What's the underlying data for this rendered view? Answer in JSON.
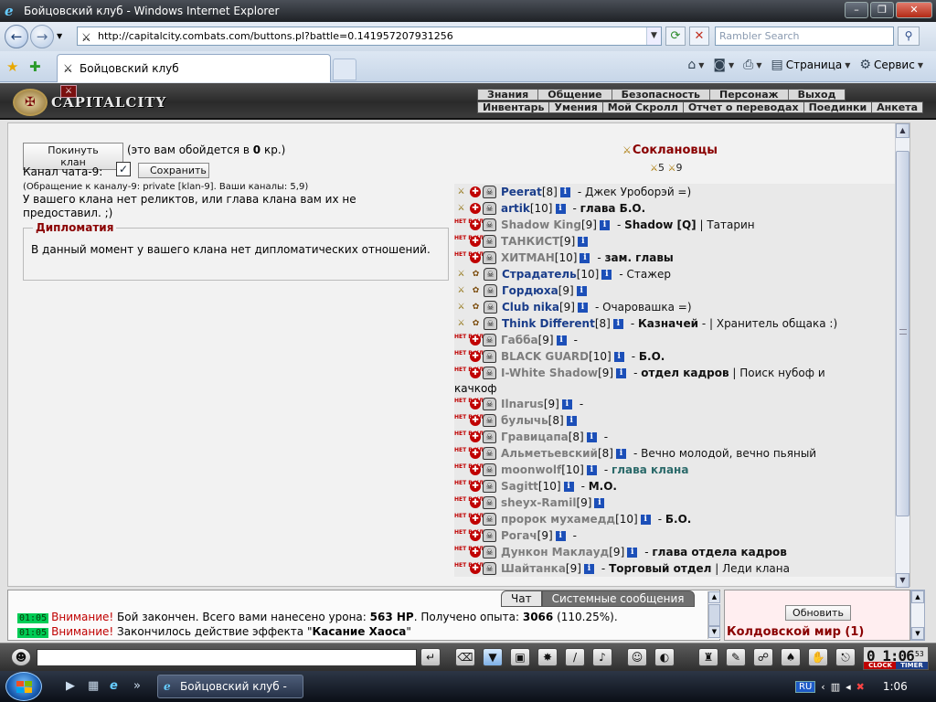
{
  "browser": {
    "window_title": "Бойцовский клуб - Windows Internet Explorer",
    "url": "http://capitalcity.combats.com/buttons.pl?battle=0.141957207931256",
    "search_placeholder": "Rambler Search",
    "tab_title": "Бойцовский клуб",
    "cmd_page": "Страница",
    "cmd_service": "Сервис"
  },
  "game": {
    "logo_text": "CAPITALCITY",
    "menu_top": [
      "Знания",
      "Общение",
      "Безопасность",
      "Персонаж",
      "Выход"
    ],
    "menu_bottom": [
      "Инвентарь",
      "Умения",
      "Мой Скролл",
      "Отчет о переводах",
      "Поединки",
      "Анкета"
    ]
  },
  "clan": {
    "leave_button": "Покинуть клан",
    "leave_note_pre": "(это вам обойдется в ",
    "leave_cost": "0",
    "leave_note_post": " кр.)",
    "channel_label": "Канал чата-9:",
    "channel_checked": "✓",
    "save_button": "Сохранить",
    "channel_info": "(Обращение к каналу-9: private [klan-9]. Ваши каналы: 5,9)",
    "relics_text": "У вашего клана нет реликтов, или глава клана вам их не предоставил. ;)",
    "diplomacy_title": "Дипломатия",
    "diplomacy_text": "В данный момент у вашего клана нет дипломатических отношений.",
    "members_title": "Соклановцы",
    "count_a": "5",
    "count_b": "9"
  },
  "members": [
    {
      "name": "Peerat",
      "level": "[8]",
      "suffix_plain": "- Джек Уроборэй =)",
      "suffix_bold": "",
      "online": true,
      "nobattle": false
    },
    {
      "name": "artik",
      "level": "[10]",
      "suffix_plain": "- ",
      "suffix_bold": "глава Б.О.",
      "online": true,
      "nobattle": false
    },
    {
      "name": "Shadow King",
      "level": "[9]",
      "suffix_plain": "- ",
      "suffix_bold": "Shadow [Q]",
      "suffix_tail": " | Татарин",
      "online": false,
      "nobattle": true
    },
    {
      "name": "ТАНКИСТ",
      "level": "[9]",
      "suffix_plain": "",
      "suffix_bold": "",
      "online": false,
      "nobattle": true
    },
    {
      "name": "ХИТМАН",
      "level": "[10]",
      "suffix_plain": "- ",
      "suffix_bold": "зам. главы",
      "online": false,
      "nobattle": true
    },
    {
      "name": "Страдатель",
      "level": "[10]",
      "suffix_plain": "- Стажер",
      "suffix_bold": "",
      "online": true,
      "nobattle": false
    },
    {
      "name": "Гордюха",
      "level": "[9]",
      "suffix_plain": "",
      "suffix_bold": "",
      "online": true,
      "nobattle": false
    },
    {
      "name": "Club nika",
      "level": "[9]",
      "suffix_plain": "- Очаровашка =)",
      "suffix_bold": "",
      "online": true,
      "nobattle": false
    },
    {
      "name": "Think Different",
      "level": "[8]",
      "suffix_plain": "- ",
      "suffix_bold": "Казначей",
      "suffix_tail": " - | Хранитель общака :)",
      "online": true,
      "nobattle": false
    },
    {
      "name": "Габба",
      "level": "[9]",
      "suffix_plain": "-",
      "suffix_bold": "",
      "online": false,
      "nobattle": true
    },
    {
      "name": "BLACK GUARD",
      "level": "[10]",
      "suffix_plain": "- ",
      "suffix_bold": "Б.О.",
      "online": false,
      "nobattle": true
    },
    {
      "name": "I-White Shadow",
      "level": "[9]",
      "suffix_plain": "- ",
      "suffix_bold": "отдел кадров",
      "suffix_tail": " | Поиск нубоф и",
      "online": false,
      "nobattle": true
    },
    {
      "name": "Ilnarus",
      "level": "[9]",
      "suffix_plain": "-",
      "suffix_bold": "",
      "online": false,
      "nobattle": true
    },
    {
      "name": "булычь",
      "level": "[8]",
      "suffix_plain": "",
      "suffix_bold": "",
      "online": false,
      "nobattle": true
    },
    {
      "name": "Гравицапа",
      "level": "[8]",
      "suffix_plain": "-",
      "suffix_bold": "",
      "online": false,
      "nobattle": true
    },
    {
      "name": "Альметьевский",
      "level": "[8]",
      "suffix_plain": "- Вечно молодой, вечно пьяный",
      "suffix_bold": "",
      "online": false,
      "nobattle": true
    },
    {
      "name": "moonwolf",
      "level": "[10]",
      "suffix_plain": "- ",
      "suffix_teal": "глава клана",
      "suffix_bold": "",
      "online": false,
      "nobattle": true
    },
    {
      "name": "Sagitt",
      "level": "[10]",
      "suffix_plain": "- ",
      "suffix_bold": "М.О.",
      "online": false,
      "nobattle": true
    },
    {
      "name": "sheyx-Ramil",
      "level": "[9]",
      "suffix_plain": "",
      "suffix_bold": "",
      "online": false,
      "nobattle": true
    },
    {
      "name": "пророк мухамедд",
      "level": "[10]",
      "suffix_plain": "- ",
      "suffix_bold": "Б.О.",
      "online": false,
      "nobattle": true
    },
    {
      "name": "Рогач",
      "level": "[9]",
      "suffix_plain": "-",
      "suffix_bold": "",
      "online": false,
      "nobattle": true
    },
    {
      "name": "Дункон Маклауд",
      "level": "[9]",
      "suffix_plain": "- ",
      "suffix_bold": "глава отдела кадров",
      "online": false,
      "nobattle": true
    },
    {
      "name": "Шайтанка",
      "level": "[9]",
      "suffix_plain": "- ",
      "suffix_bold": "Торговый отдел",
      "suffix_tail": " | Леди клана",
      "online": false,
      "nobattle": true
    }
  ],
  "wrap_continuation": "качкоф",
  "nobattle_label": "НЕТ В КЛУБЕ",
  "chat": {
    "tab_chat": "Чат",
    "tab_system": "Системные сообщения",
    "line1": {
      "time": "01:05",
      "warn": "Внимание!",
      "pre": " Бой закончен. Всего вами нанесено урона: ",
      "dmg": "563 HP",
      "mid": ". Получено опыта: ",
      "exp": "3066",
      "post": " (110.25%)."
    },
    "line2": {
      "time": "01:05",
      "warn": "Внимание!",
      "pre": " Закончилось действие эффекта \"",
      "effect": "Касание Хаоса",
      "post": "\""
    },
    "refresh_button": "Обновить",
    "location": "Колдовской мир (1)"
  },
  "clock": {
    "time": "0 1:06",
    "secs": "53",
    "label1": "CLOCK",
    "label2": "TIMER"
  },
  "taskbar": {
    "item": "Бойцовский клуб - Wi...",
    "lang": "RU",
    "time": "1:06"
  }
}
